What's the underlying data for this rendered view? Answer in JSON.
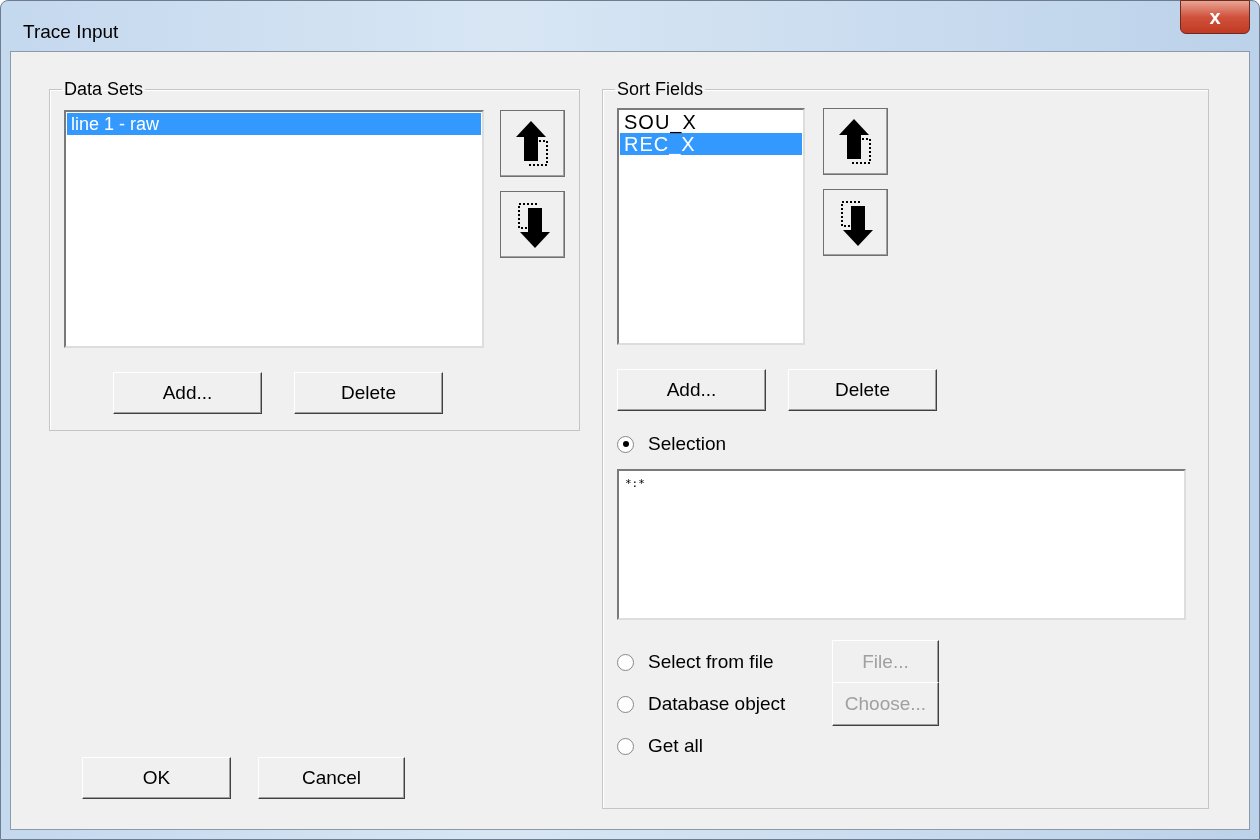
{
  "window": {
    "title": "Trace Input",
    "close": "x"
  },
  "data_sets": {
    "title": "Data Sets",
    "items": [
      {
        "label": "line 1 - raw",
        "selected": true
      }
    ],
    "buttons": [
      "Add...",
      "Delete"
    ]
  },
  "sort_fields": {
    "title": "Sort Fields",
    "items": [
      {
        "label": "SOU_X",
        "selected": false
      },
      {
        "label": "REC_X",
        "selected": true
      }
    ],
    "buttons": [
      "Add...",
      "Delete"
    ],
    "options": [
      {
        "kind": "text",
        "label": "Selection",
        "selected": true,
        "value": "*:*"
      },
      {
        "kind": "button",
        "label": "Select from file",
        "selected": false,
        "button": "File...",
        "disabled": true
      },
      {
        "kind": "button",
        "label": "Database object",
        "selected": false,
        "button": "Choose...",
        "disabled": true
      },
      {
        "kind": "plain",
        "label": "Get all",
        "selected": false
      }
    ]
  },
  "footer": {
    "buttons": [
      "OK",
      "Cancel"
    ]
  }
}
